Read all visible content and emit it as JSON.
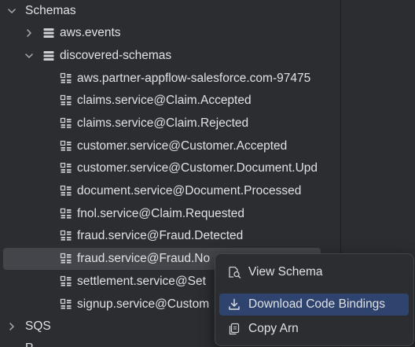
{
  "tree": {
    "schemas_label": "Schemas",
    "aws_events_label": "aws.events",
    "discovered_schemas_label": "discovered-schemas",
    "items": [
      "aws.partner-appflow-salesforce.com-97475",
      "claims.service@Claim.Accepted",
      "claims.service@Claim.Rejected",
      "customer.service@Customer.Accepted",
      "customer.service@Customer.Document.Upd",
      "document.service@Document.Processed",
      "fnol.service@Claim.Requested",
      "fraud.service@Fraud.Detected",
      "fraud.service@Fraud.No",
      "settlement.service@Set",
      "signup.service@Custom"
    ],
    "sqs_label": "SQS",
    "partial_next_label": "P"
  },
  "context_menu": {
    "view_schema": "View Schema",
    "download_code_bindings": "Download Code Bindings",
    "copy_arn": "Copy Arn"
  },
  "icons": {
    "chevron_right": "chevron-right-icon",
    "chevron_down": "chevron-down-icon",
    "registry": "registry-icon",
    "schema": "schema-icon",
    "search_doc": "search-document-icon",
    "download": "download-icon",
    "copy": "copy-icon"
  },
  "colors": {
    "background": "#2b2d30",
    "selection": "#43454a",
    "menu_highlight": "#2e436e",
    "text": "#dfe1e5"
  }
}
